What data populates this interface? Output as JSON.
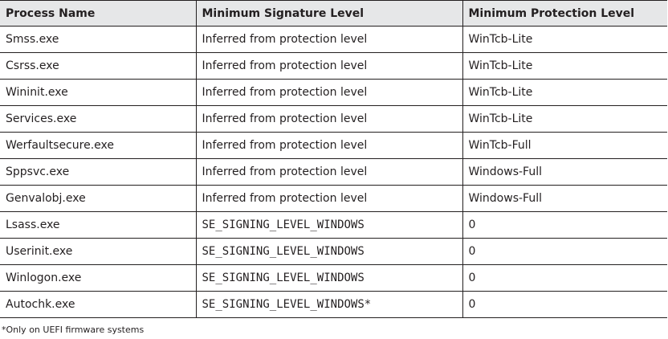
{
  "table": {
    "headers": [
      "Process Name",
      "Minimum Signature Level",
      "Minimum Protection Level"
    ],
    "rows": [
      [
        "Smss.exe",
        "Inferred from protection level",
        "WinTcb-Lite"
      ],
      [
        "Csrss.exe",
        "Inferred from protection level",
        "WinTcb-Lite"
      ],
      [
        "Wininit.exe",
        "Inferred from protection level",
        "WinTcb-Lite"
      ],
      [
        "Services.exe",
        "Inferred from protection level",
        "WinTcb-Lite"
      ],
      [
        "Werfaultsecure.exe",
        "Inferred from protection level",
        "WinTcb-Full"
      ],
      [
        "Sppsvc.exe",
        "Inferred from protection level",
        "Windows-Full"
      ],
      [
        "Genvalobj.exe",
        "Inferred from protection level",
        "Windows-Full"
      ],
      [
        "Lsass.exe",
        "SE_SIGNING_LEVEL_WINDOWS",
        "0"
      ],
      [
        "Userinit.exe",
        "SE_SIGNING_LEVEL_WINDOWS",
        "0"
      ],
      [
        "Winlogon.exe",
        "SE_SIGNING_LEVEL_WINDOWS",
        "0"
      ],
      [
        "Autochk.exe",
        "SE_SIGNING_LEVEL_WINDOWS*",
        "0"
      ]
    ]
  },
  "footnote": "*Only on UEFI firmware systems"
}
